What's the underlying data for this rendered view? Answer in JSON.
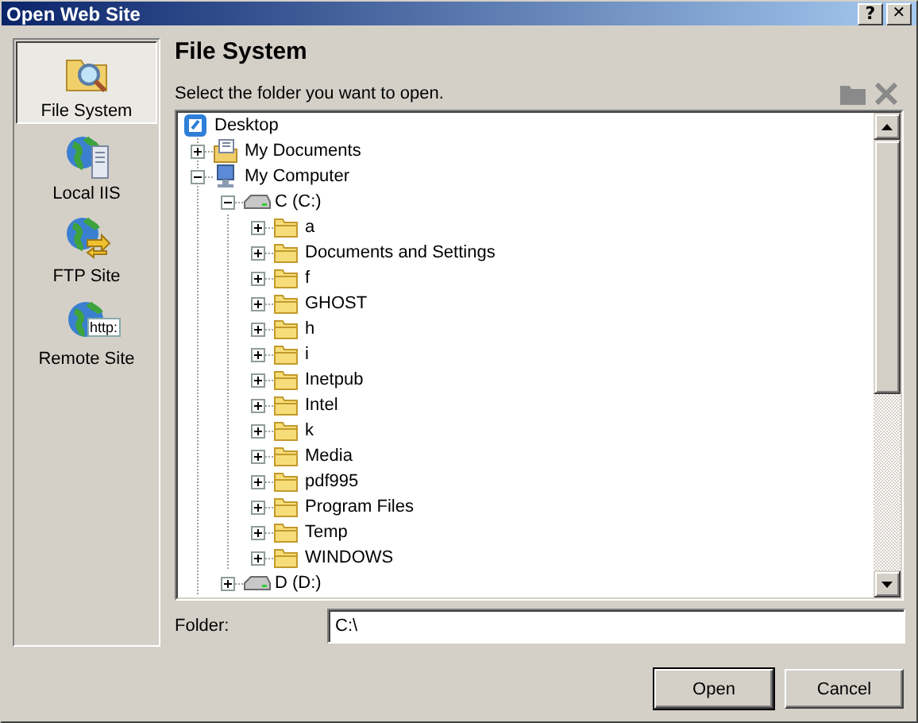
{
  "window": {
    "title": "Open Web Site",
    "buttons": [
      {
        "kind": "help",
        "label": "?"
      },
      {
        "kind": "close",
        "label": "✕"
      }
    ]
  },
  "sidebar": {
    "items": [
      {
        "label": "File System",
        "kind": "filesystem",
        "selected": true
      },
      {
        "label": "Local IIS",
        "kind": "localiis",
        "selected": false
      },
      {
        "label": "FTP Site",
        "kind": "ftp",
        "selected": false
      },
      {
        "label": "Remote Site",
        "kind": "remote",
        "badge": "http:",
        "selected": false
      }
    ]
  },
  "header": {
    "title": "File System",
    "instruction": "Select the folder you want to open."
  },
  "tree": [
    {
      "label": "Desktop",
      "kind": "desktop",
      "children": [
        {
          "label": "My Documents",
          "kind": "documents",
          "expanded": false
        },
        {
          "label": "My Computer",
          "kind": "computer",
          "expanded": true,
          "children": [
            {
              "label": "C (C:)",
              "kind": "drive",
              "expanded": true,
              "children": [
                {
                  "label": "a",
                  "kind": "folder",
                  "expanded": false
                },
                {
                  "label": "Documents and Settings",
                  "kind": "folder",
                  "expanded": false
                },
                {
                  "label": "f",
                  "kind": "folder",
                  "expanded": false
                },
                {
                  "label": "GHOST",
                  "kind": "folder",
                  "expanded": false
                },
                {
                  "label": "h",
                  "kind": "folder",
                  "expanded": false
                },
                {
                  "label": "i",
                  "kind": "folder",
                  "expanded": false
                },
                {
                  "label": "Inetpub",
                  "kind": "folder",
                  "expanded": false
                },
                {
                  "label": "Intel",
                  "kind": "folder",
                  "expanded": false
                },
                {
                  "label": "k",
                  "kind": "folder",
                  "expanded": false
                },
                {
                  "label": "Media",
                  "kind": "folder",
                  "expanded": false
                },
                {
                  "label": "pdf995",
                  "kind": "folder",
                  "expanded": false
                },
                {
                  "label": "Program Files",
                  "kind": "folder",
                  "expanded": false
                },
                {
                  "label": "Temp",
                  "kind": "folder",
                  "expanded": false
                },
                {
                  "label": "WINDOWS",
                  "kind": "folder",
                  "expanded": false
                }
              ]
            },
            {
              "label": "D (D:)",
              "kind": "drive",
              "expanded": false
            }
          ]
        }
      ]
    }
  ],
  "folder": {
    "label": "Folder:",
    "value": "C:\\"
  },
  "buttons": [
    {
      "label": "Open",
      "default": true
    },
    {
      "label": "Cancel",
      "default": false
    }
  ]
}
